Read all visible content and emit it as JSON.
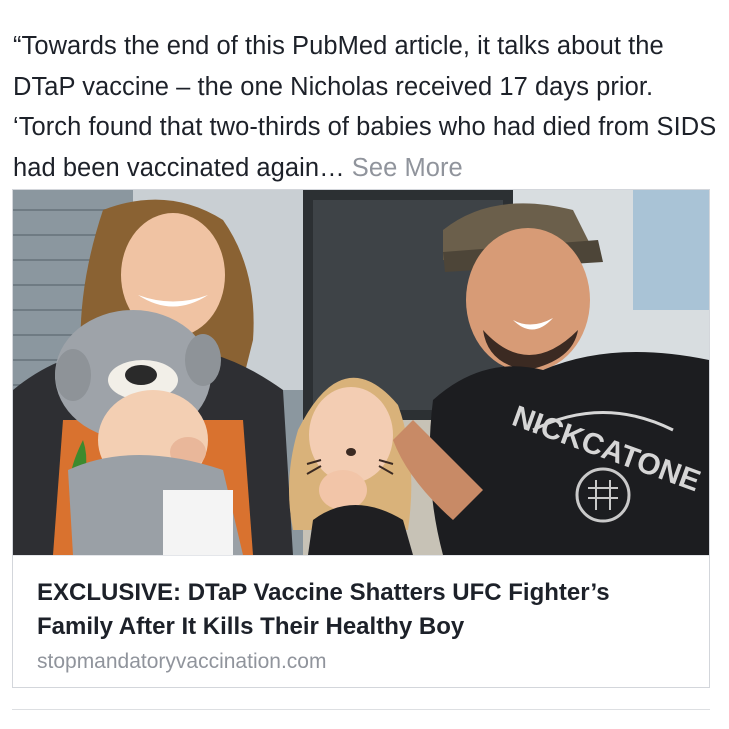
{
  "post": {
    "text": "“Towards the end of this PubMed article, it talks about the DTaP vaccine – the one Nicholas received 17 days prior. ‘Torch found that two-thirds of babies who had died from SIDS had been vaccinated again…",
    "see_more": "See More"
  },
  "link_card": {
    "headline": "EXCLUSIVE: DTaP Vaccine Shatters UFC Fighter’s Family After It Kills Their Healthy Boy",
    "domain": "stopmandatoryvaccination.com",
    "photo_shirt_text": "NICKCATONE"
  }
}
